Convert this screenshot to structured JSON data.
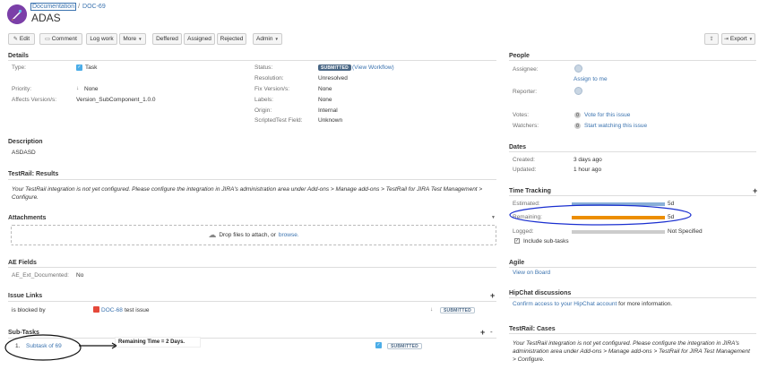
{
  "header": {
    "breadcrumb_project": "Documentation",
    "breadcrumb_separator": "/",
    "breadcrumb_key": "DOC-69",
    "title": "ADAS"
  },
  "toolbar": {
    "edit": "Edit",
    "comment": "Comment",
    "log_work": "Log work",
    "more": "More",
    "deffered": "Deffered",
    "assigned": "Assigned",
    "rejected": "Rejected",
    "admin": "Admin",
    "export": "Export"
  },
  "details": {
    "heading": "Details",
    "type_label": "Type:",
    "type_value": "Task",
    "priority_label": "Priority:",
    "priority_value": "None",
    "affects_label": "Affects Version/s:",
    "affects_value": "Version_SubComponent_1.0.0",
    "status_label": "Status:",
    "status_value": "SUBMITTED",
    "status_link": "(View Workflow)",
    "resolution_label": "Resolution:",
    "resolution_value": "Unresolved",
    "fix_label": "Fix Version/s:",
    "fix_value": "None",
    "labels_label": "Labels:",
    "labels_value": "None",
    "origin_label": "Origin:",
    "origin_value": "Internal",
    "scripted_label": "ScriptedTest Field:",
    "scripted_value": "Unknown"
  },
  "description": {
    "heading": "Description",
    "text": "ASDASD"
  },
  "testrail_results": {
    "heading": "TestRail: Results",
    "text": "Your TestRail integration is not yet configured. Please configure the integration in JIRA's administration area under Add-ons > Manage add-ons > TestRail for JIRA Test Management > Configure."
  },
  "attachments": {
    "heading": "Attachments",
    "drop_text": "Drop files to attach, or",
    "browse": "browse."
  },
  "ae_fields": {
    "heading": "AE Fields",
    "label": "AE_Ext_Documented:",
    "value": "No"
  },
  "issue_links": {
    "heading": "Issue Links",
    "relation": "is blocked by",
    "link_key": "DOC-68",
    "link_summary": "test issue",
    "link_status": "SUBMITTED"
  },
  "subtasks": {
    "heading": "Sub-Tasks",
    "items": [
      {
        "num": "1.",
        "summary": "Subtask of 69",
        "status": "SUBMITTED"
      }
    ],
    "annotation": "Remaining Time = 2 Days."
  },
  "people": {
    "heading": "People",
    "assignee_label": "Assignee:",
    "assign_to_me": "Assign to me",
    "reporter_label": "Reporter:",
    "votes_label": "Votes:",
    "votes_count": "0",
    "vote_link": "Vote for this issue",
    "watchers_label": "Watchers:",
    "watchers_count": "0",
    "watch_link": "Start watching this issue"
  },
  "dates": {
    "heading": "Dates",
    "created_label": "Created:",
    "created_value": "3 days ago",
    "updated_label": "Updated:",
    "updated_value": "1 hour ago"
  },
  "time_tracking": {
    "heading": "Time Tracking",
    "estimated_label": "Estimated:",
    "estimated_value": "5d",
    "estimated_fraction": 1.0,
    "remaining_label": "Remaining:",
    "remaining_value": "5d",
    "remaining_fraction": 1.0,
    "logged_label": "Logged:",
    "logged_value": "Not Specified",
    "logged_fraction": 0.0,
    "include_subtasks": "Include sub-tasks",
    "colors": {
      "estimated": "#89afd7",
      "remaining": "#ec8e00",
      "logged": "#cccccc"
    }
  },
  "agile": {
    "heading": "Agile",
    "link": "View on Board"
  },
  "hipchat": {
    "heading": "HipChat discussions",
    "link": "Confirm access to your HipChat account",
    "suffix": "for more information."
  },
  "testrail_cases": {
    "heading": "TestRail: Cases",
    "text": "Your TestRail integration is not yet configured. Please configure the integration in JIRA's administration area under Add-ons > Manage add-ons > TestRail for JIRA Test Management > Configure."
  },
  "icons": {
    "edit": "pencil-icon",
    "comment": "speech-bubble-icon",
    "share": "share-icon",
    "export": "export-icon",
    "task": "task-icon",
    "priority": "arrow-down-icon",
    "blocker": "bug-icon",
    "cloud": "cloud-upload-icon"
  }
}
